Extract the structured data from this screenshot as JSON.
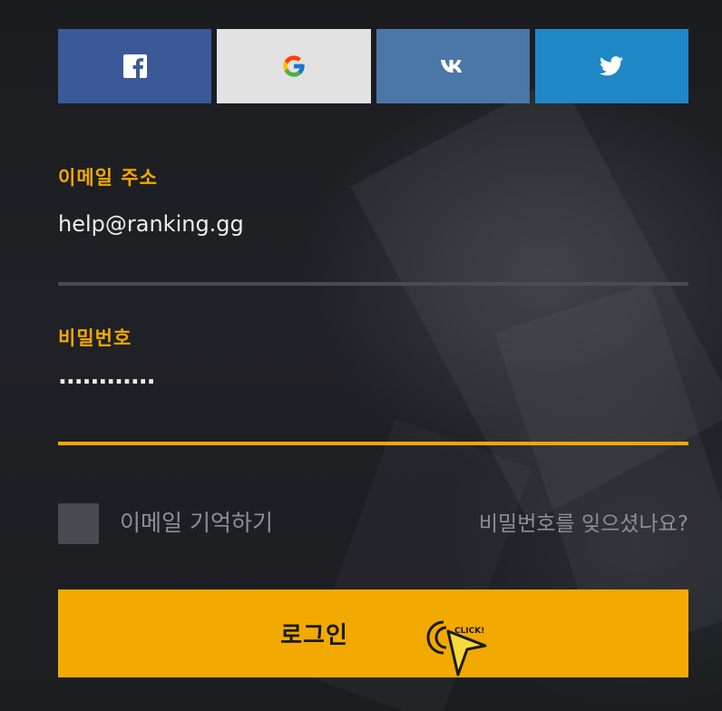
{
  "social": {
    "buttons": [
      {
        "name": "facebook",
        "icon": "facebook-icon",
        "color": "#3b5998"
      },
      {
        "name": "google",
        "icon": "google-icon",
        "color": "#e2e2e2"
      },
      {
        "name": "vk",
        "icon": "vk-icon",
        "color": "#4a76a8"
      },
      {
        "name": "twitter",
        "icon": "twitter-icon",
        "color": "#1f87c6"
      }
    ]
  },
  "email": {
    "label": "이메일 주소",
    "value": "help@ranking.gg"
  },
  "password": {
    "label": "비밀번호",
    "masked_value": "............"
  },
  "remember": {
    "label": "이메일 기억하기",
    "checked": false
  },
  "forgot": {
    "label": "비밀번호를 잊으셨나요?"
  },
  "login": {
    "label": "로그인",
    "cursor_badge": "CLICK!"
  },
  "colors": {
    "accent": "#f2a900",
    "background": "#1c1d21",
    "input_underline": "#4a4c52",
    "active_underline": "#f2a900"
  }
}
